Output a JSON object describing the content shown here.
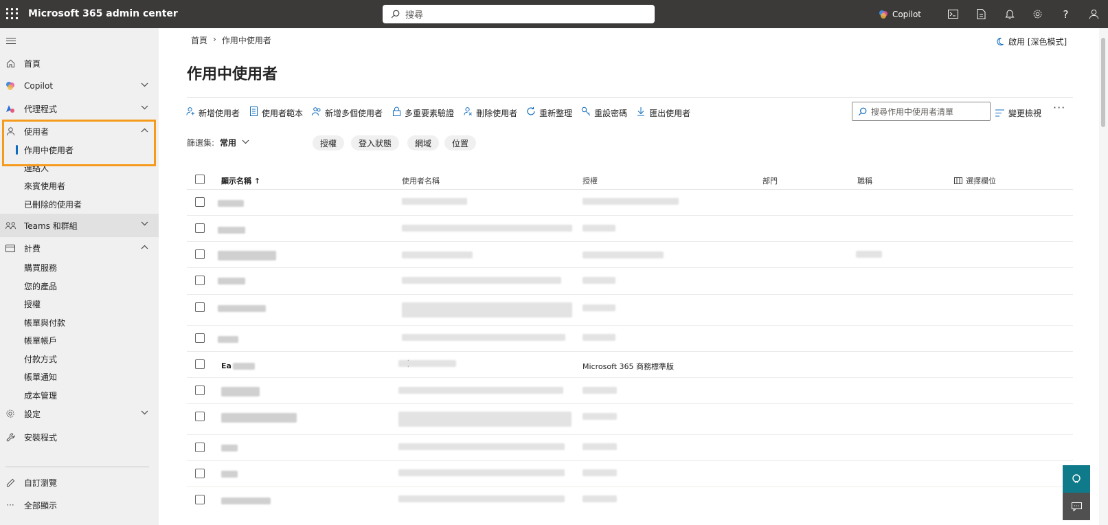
{
  "app": {
    "title": "Microsoft 365 admin center",
    "search_placeholder": "搜尋",
    "copilot_label": "Copilot"
  },
  "sidebar": {
    "home": "首頁",
    "copilot": "Copilot",
    "agents": "代理程式",
    "users": "使用者",
    "users_children": [
      "作用中使用者",
      "連絡人",
      "來賓使用者",
      "已刪除的使用者"
    ],
    "teams": "Teams 和群組",
    "billing": "計費",
    "billing_children": [
      "購買服務",
      "您的產品",
      "授權",
      "帳單與付款",
      "帳單帳戶",
      "付款方式",
      "帳單通知",
      "成本管理"
    ],
    "settings": "設定",
    "setup": "安裝程式",
    "customize": "自訂瀏覽",
    "show_all": "全部顯示"
  },
  "breadcrumb": [
    "首頁",
    "作用中使用者"
  ],
  "dark_mode_label": "啟用 [深色模式]",
  "page_title": "作用中使用者",
  "commands": [
    {
      "label": "新增使用者",
      "icon": "add-user-icon"
    },
    {
      "label": "使用者範本",
      "icon": "template-icon"
    },
    {
      "label": "新增多個使用者",
      "icon": "add-multiple-users-icon"
    },
    {
      "label": "多重要素驗證",
      "icon": "lock-icon"
    },
    {
      "label": "刪除使用者",
      "icon": "delete-user-icon"
    },
    {
      "label": "重新整理",
      "icon": "refresh-icon"
    },
    {
      "label": "重設密碼",
      "icon": "key-icon"
    },
    {
      "label": "匯出使用者",
      "icon": "download-icon"
    }
  ],
  "list_search_placeholder": "搜尋作用中使用者清單",
  "change_view_label": "變更檢視",
  "filter": {
    "label": "篩選集:",
    "value": "常用",
    "pills": [
      "授權",
      "登入狀態",
      "網域",
      "位置"
    ]
  },
  "table": {
    "columns": [
      "顯示名稱",
      "使用者名稱",
      "授權",
      "部門",
      "職稱",
      "選擇欄位"
    ],
    "sort_indicator": "↑",
    "visible_row": {
      "name": "Ea",
      "license": "Microsoft 365 商務標準版"
    }
  },
  "colors": {
    "topbar": "#3b3a39",
    "accent": "#0f6cbd",
    "highlight": "#f59a1b",
    "help_button": "#0e7a8a"
  }
}
